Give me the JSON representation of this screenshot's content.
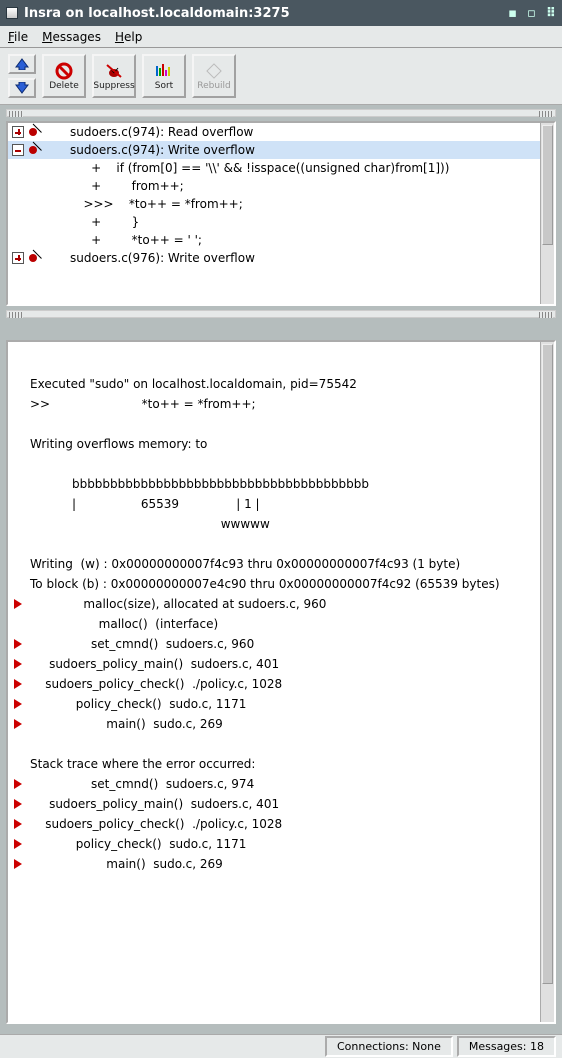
{
  "titlebar": {
    "text": "Insra on localhost.localdomain:3275"
  },
  "menus": {
    "file": "File",
    "messages": "Messages",
    "help": "Help"
  },
  "toolbar": {
    "delete": "Delete",
    "suppress": "Suppress",
    "sort": "Sort",
    "rebuild": "Rebuild"
  },
  "summary": {
    "rows": [
      "sudoers.c(974): Read overflow",
      "sudoers.c(974): Write overflow",
      "     +    if (from[0] == '\\\\' && !isspace((unsigned char)from[1]))",
      "     +        from++;",
      "   >>>    *to++ = *from++;",
      "     +        }",
      "     +        *to++ = ' ';",
      "sudoers.c(976): Write overflow"
    ]
  },
  "detail": {
    "executed": "Executed \"sudo\" on localhost.localdomain, pid=75542",
    "arrow": ">>                        *to++ = *from++;",
    "writing": "Writing overflows memory: to",
    "bar": "           bbbbbbbbbbbbbbbbbbbbbbbbbbbbbbbbbbbbbbb",
    "bar2": "           |                 65539               | 1 |",
    "bar3": "                                                  wwwww",
    "wline": "Writing  (w) : 0x00000000007f4c93 thru 0x00000000007f4c93 (1 byte)",
    "bline": "To block (b) : 0x00000000007e4c90 thru 0x00000000007f4c92 (65539 bytes)",
    "stack1": [
      "              malloc(size), allocated at sudoers.c, 960",
      "                  malloc()  (interface)",
      "                set_cmnd()  sudoers.c, 960",
      "     sudoers_policy_main()  sudoers.c, 401",
      "    sudoers_policy_check()  ./policy.c, 1028",
      "            policy_check()  sudo.c, 1171",
      "                    main()  sudo.c, 269"
    ],
    "tracehdr": "Stack trace where the error occurred:",
    "stack2": [
      "                set_cmnd()  sudoers.c, 974",
      "     sudoers_policy_main()  sudoers.c, 401",
      "    sudoers_policy_check()  ./policy.c, 1028",
      "            policy_check()  sudo.c, 1171",
      "                    main()  sudo.c, 269"
    ]
  },
  "status": {
    "conn": "Connections: None",
    "msgs": "Messages: 18"
  }
}
